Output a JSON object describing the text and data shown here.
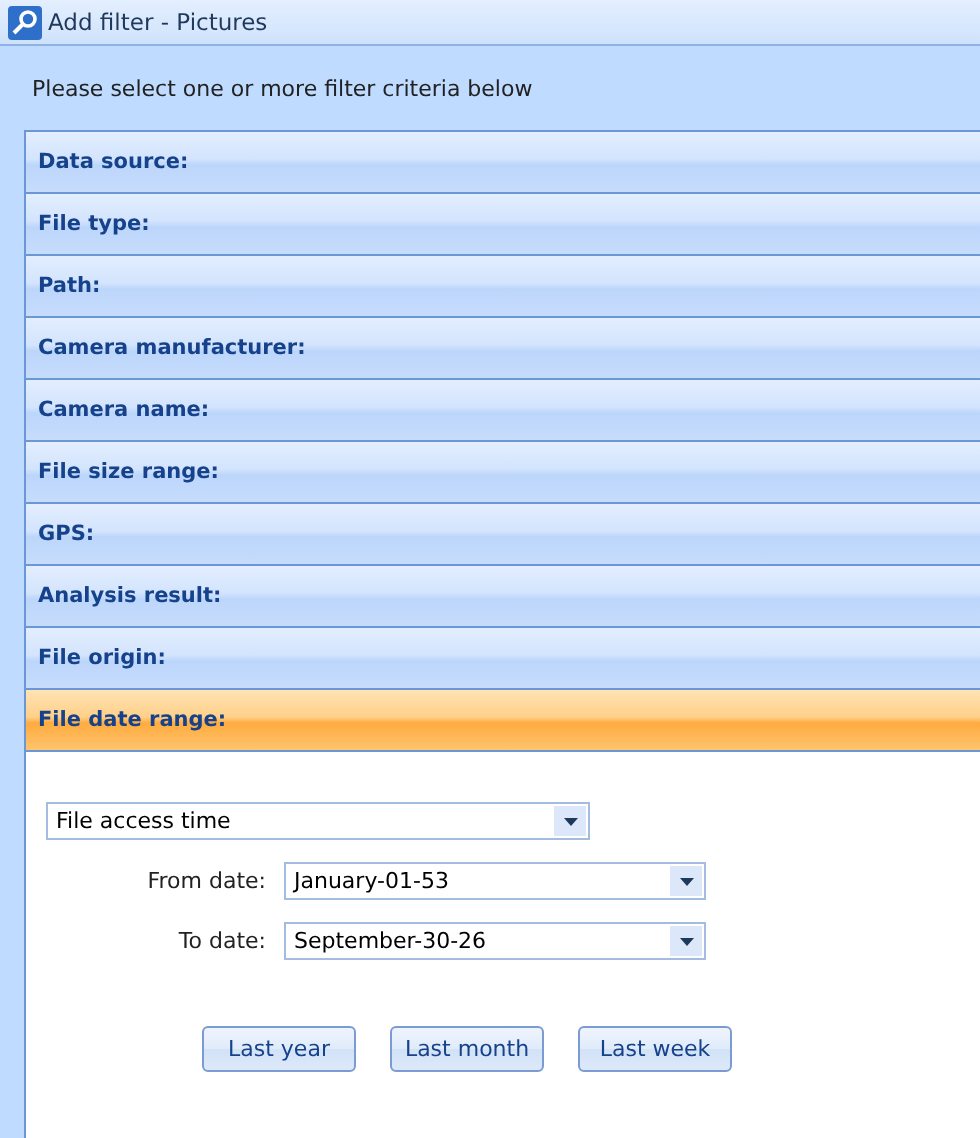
{
  "window": {
    "title": "Add filter - Pictures"
  },
  "instruction": "Please select one or more filter criteria below",
  "sections": [
    {
      "label": "Data source:",
      "selected": false
    },
    {
      "label": "File type:",
      "selected": false
    },
    {
      "label": "Path:",
      "selected": false
    },
    {
      "label": "Camera manufacturer:",
      "selected": false
    },
    {
      "label": "Camera name:",
      "selected": false
    },
    {
      "label": "File size range:",
      "selected": false
    },
    {
      "label": "GPS:",
      "selected": false
    },
    {
      "label": "Analysis result:",
      "selected": false
    },
    {
      "label": "File origin:",
      "selected": false
    },
    {
      "label": "File date range:",
      "selected": true
    }
  ],
  "date_type": {
    "value": "File access time"
  },
  "fields": [
    {
      "label": "From date:",
      "value": "January-01-53"
    },
    {
      "label": "To date:",
      "value": "September-30-26"
    }
  ],
  "buttons": [
    "Last year",
    "Last month",
    "Last week"
  ]
}
